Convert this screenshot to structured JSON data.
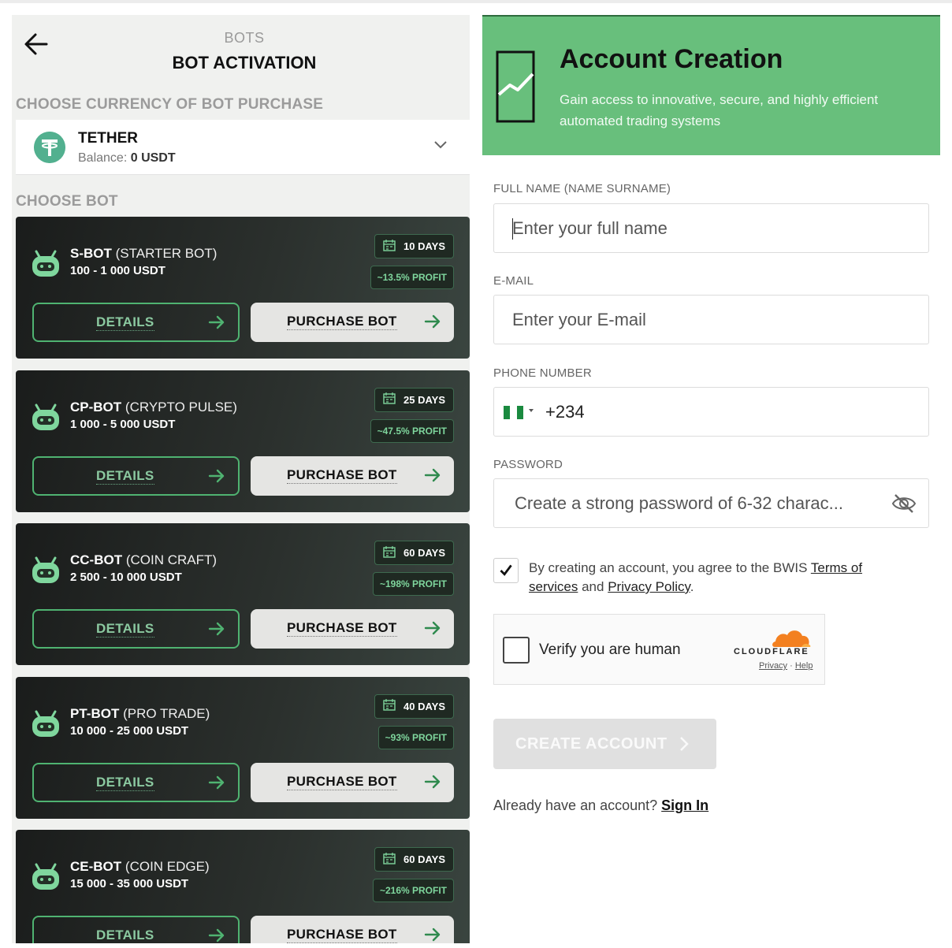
{
  "left": {
    "breadcrumb_small": "BOTS",
    "breadcrumb_title": "BOT ACTIVATION",
    "currency_section_label": "CHOOSE CURRENCY OF BOT PURCHASE",
    "currency": {
      "name": "TETHER",
      "balance_label": "Balance:",
      "balance_value": "0 USDT"
    },
    "bot_section_label": "CHOOSE BOT",
    "bots": [
      {
        "code": "S-BOT",
        "full": "(STARTER BOT)",
        "range": "100 - 1 000 USDT",
        "days": "10 DAYS",
        "profit": "~13.5% PROFIT",
        "details": "DETAILS",
        "purchase": "PURCHASE BOT"
      },
      {
        "code": "CP-BOT",
        "full": "(CRYPTO PULSE)",
        "range": "1 000 - 5 000 USDT",
        "days": "25 DAYS",
        "profit": "~47.5% PROFIT",
        "details": "DETAILS",
        "purchase": "PURCHASE BOT"
      },
      {
        "code": "CC-BOT",
        "full": "(COIN CRAFT)",
        "range": "2 500 - 10 000 USDT",
        "days": "60 DAYS",
        "profit": "~198% PROFIT",
        "details": "DETAILS",
        "purchase": "PURCHASE BOT"
      },
      {
        "code": "PT-BOT",
        "full": "(PRO TRADE)",
        "range": "10 000 - 25 000 USDT",
        "days": "40 DAYS",
        "profit": "~93% PROFIT",
        "details": "DETAILS",
        "purchase": "PURCHASE BOT"
      },
      {
        "code": "CE-BOT",
        "full": "(COIN EDGE)",
        "range": "15 000 - 35 000 USDT",
        "days": "60 DAYS",
        "profit": "~216% PROFIT",
        "details": "DETAILS",
        "purchase": "PURCHASE BOT"
      }
    ]
  },
  "right": {
    "hero_title": "Account Creation",
    "hero_subtitle": "Gain access to innovative, secure, and highly efficient automated trading systems",
    "full_name_label": "FULL NAME (NAME SURNAME)",
    "full_name_placeholder": "Enter your full name",
    "email_label": "E-MAIL",
    "email_placeholder": "Enter your E-mail",
    "phone_label": "PHONE NUMBER",
    "phone_value": "+234",
    "password_label": "PASSWORD",
    "password_placeholder": "Create a strong password of 6-32 charac...",
    "terms_prefix": "By creating an account, you agree to the BWIS",
    "terms_link": "Terms of services",
    "terms_and": "and",
    "privacy_link": "Privacy Policy",
    "terms_suffix": ".",
    "captcha_text": "Verify you are human",
    "cloudflare_word": "CLOUDFLARE",
    "cf_privacy": "Privacy",
    "cf_sep": "·",
    "cf_help": "Help",
    "create_button": "CREATE ACCOUNT",
    "signin_prompt": "Already have an account?",
    "signin_link": "Sign In"
  },
  "colors": {
    "accent_green": "#68bf7c",
    "bot_card_dark": "#1a1c1b",
    "profit_green": "#7fd69d",
    "tether_green": "#52b08f",
    "nigeria_flag_green": "#1a8a3f"
  },
  "icons": [
    "back-arrow-icon",
    "tether-icon",
    "chevron-down-icon",
    "robot-icon",
    "calendar-icon",
    "arrow-right-icon",
    "chart-trend-icon",
    "eye-off-icon",
    "checkmark-icon",
    "cloudflare-icon",
    "chevron-right-icon"
  ]
}
